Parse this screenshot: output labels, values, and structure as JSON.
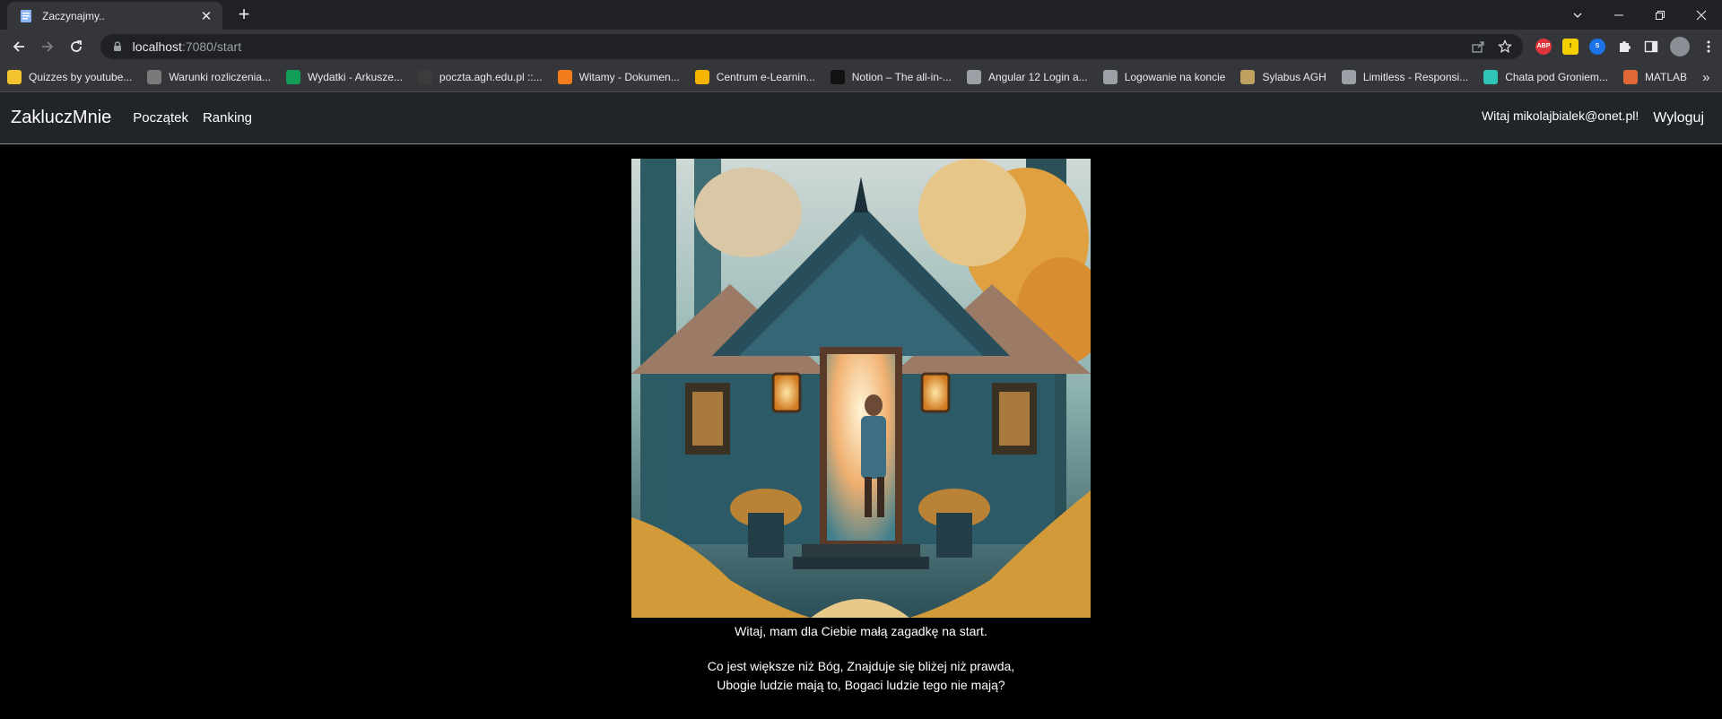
{
  "browser": {
    "tab_title": "Zaczynajmy..",
    "url_host": "localhost",
    "url_path": ":7080/start",
    "bookmarks": [
      {
        "label": "Quizzes by youtube...",
        "icon": "yellow-square-icon",
        "color": "#f4c430"
      },
      {
        "label": "Warunki rozliczenia...",
        "icon": "grey-circle-e-icon",
        "color": "#7a7a7a"
      },
      {
        "label": "Wydatki - Arkusze...",
        "icon": "sheets-icon",
        "color": "#0f9d58"
      },
      {
        "label": "poczta.agh.edu.pl ::...",
        "icon": "mail-icon",
        "color": "#3c3c3c"
      },
      {
        "label": "Witamy - Dokumen...",
        "icon": "u-logo-icon",
        "color": "#f27d1c"
      },
      {
        "label": "Centrum e-Learnin...",
        "icon": "elearning-icon",
        "color": "#f4b400"
      },
      {
        "label": "Notion – The all-in-...",
        "icon": "notion-icon",
        "color": "#111111"
      },
      {
        "label": "Angular 12 Login a...",
        "icon": "page-icon",
        "color": "#9aa0a6"
      },
      {
        "label": "Logowanie na koncie",
        "icon": "globe-icon",
        "color": "#9aa0a6"
      },
      {
        "label": "Sylabus AGH",
        "icon": "books-icon",
        "color": "#c0a060"
      },
      {
        "label": "Limitless - Responsi...",
        "icon": "globe-icon",
        "color": "#9aa0a6"
      },
      {
        "label": "Chata pod Groniem...",
        "icon": "chata-icon",
        "color": "#2ec4b6"
      },
      {
        "label": "MATLAB",
        "icon": "matlab-icon",
        "color": "#e16737"
      }
    ],
    "bookmarks_more": "»"
  },
  "app": {
    "brand": "ZakluczMnie",
    "nav": [
      "Początek",
      "Ranking"
    ],
    "greeting": "Witaj mikolajbialek@onet.pl!",
    "logout": "Wyloguj",
    "intro": "Witaj, mam dla Ciebie małą zagadkę na start.",
    "riddle_line1": "Co jest większe niż Bóg, Znajduje się bliżej niż prawda,",
    "riddle_line2": "Ubogie ludzie mają to, Bogaci ludzie tego nie mają?"
  }
}
